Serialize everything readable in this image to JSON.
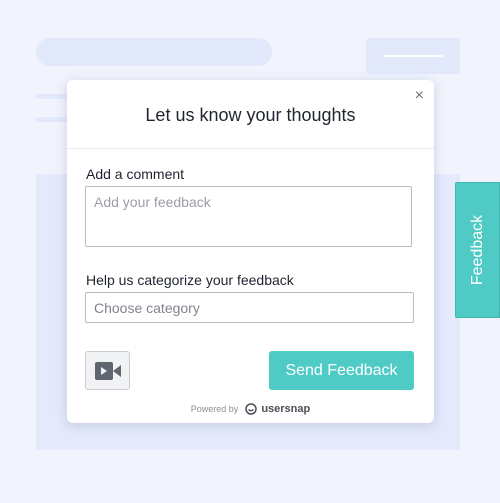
{
  "modal": {
    "title": "Let us know your thoughts",
    "close_glyph": "×",
    "comment_label": "Add a comment",
    "comment_placeholder": "Add your feedback",
    "category_label": "Help us categorize your feedback",
    "category_placeholder": "Choose category",
    "video_icon": "video-camera-icon",
    "send_label": "Send Feedback",
    "powered_prefix": "Powered by",
    "brand_icon": "usersnap-logo-icon",
    "brand": "usersnap"
  },
  "side_tab": {
    "label": "Feedback"
  },
  "colors": {
    "accent": "#4fcac4",
    "background": "#f1f4fd",
    "placeholder_block": "#e2e9fb",
    "text": "#1f2430"
  }
}
